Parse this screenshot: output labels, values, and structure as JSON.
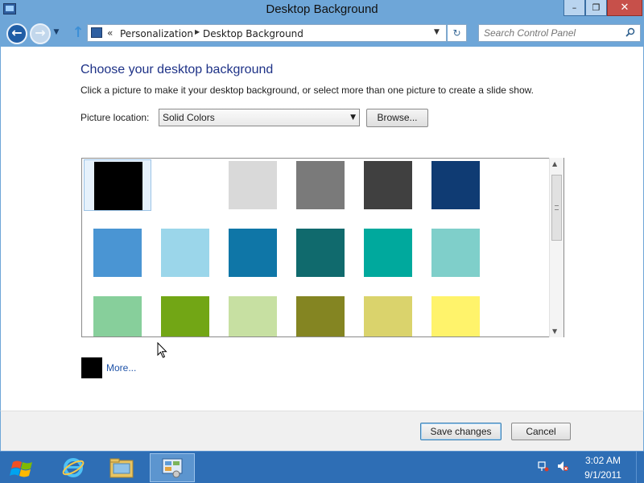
{
  "window": {
    "title": "Desktop Background",
    "controls": {
      "minimize": "–",
      "restore": "❐",
      "close": "✕"
    }
  },
  "address_bar": {
    "overflow": "«",
    "breadcrumb": [
      "Personalization",
      "Desktop Background"
    ],
    "separator": "▶",
    "dropdown": "▼"
  },
  "nav": {
    "back": "←",
    "forward": "→",
    "history": "▼",
    "up": "↑",
    "refresh": "↻"
  },
  "search": {
    "placeholder": "Search Control Panel",
    "icon": "search-icon"
  },
  "main": {
    "heading": "Choose your desktop background",
    "subtext": "Click a picture to make it your desktop background, or select more than one picture to create a slide show.",
    "picture_location_label": "Picture location:",
    "picture_location_value": "Solid Colors",
    "browse_label": "Browse...",
    "more_label": "More...",
    "more_color": "#000000"
  },
  "swatches": [
    [
      "#000000",
      "#ffffff",
      "#d9d9d9",
      "#7a7a7a",
      "#404040",
      "#0f3b73"
    ],
    [
      "#4a95d3",
      "#9bd6ea",
      "#0f76a7",
      "#106a6d",
      "#00a99d",
      "#7fcfca"
    ],
    [
      "#87cf9b",
      "#72a615",
      "#c7e0a2",
      "#848522",
      "#dad36c",
      "#fff36b"
    ]
  ],
  "selected_swatch": "#000000",
  "footer": {
    "save_label": "Save changes",
    "cancel_label": "Cancel"
  },
  "taskbar": {
    "apps": [
      "start-icon",
      "internet-explorer-icon",
      "file-explorer-icon",
      "control-panel-icon"
    ],
    "clock_time": "3:02 AM",
    "clock_date": "9/1/2011"
  }
}
